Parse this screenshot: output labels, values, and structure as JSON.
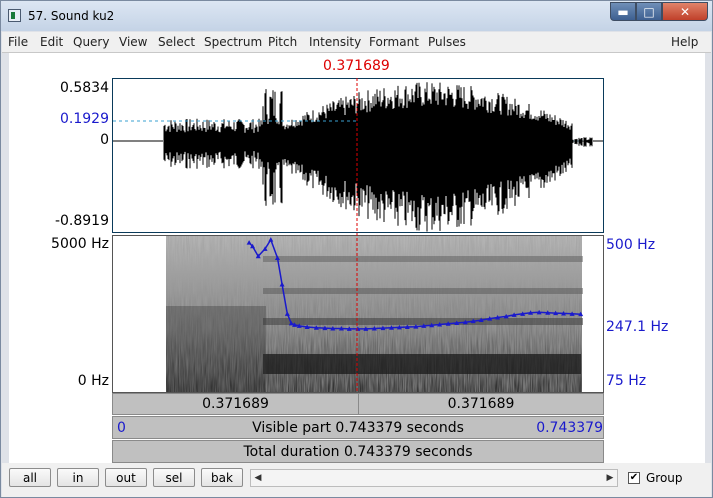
{
  "window": {
    "title": "57. Sound ku2",
    "minimize": "▬",
    "maximize": "□",
    "close": "✕"
  },
  "menu": [
    "File",
    "Edit",
    "Query",
    "View",
    "Select",
    "Spectrum",
    "Pitch",
    "Intensity",
    "Formant",
    "Pulses",
    "Help"
  ],
  "cursor": {
    "time": "0.371689"
  },
  "waveform": {
    "max": "0.5834",
    "cursor_value": "0.1929",
    "zero": "0",
    "min": "-0.8919"
  },
  "spectrogram": {
    "freq_max": "5000 Hz",
    "freq_min": "0 Hz",
    "pitch_max": "500 Hz",
    "pitch_cursor": "247.1 Hz",
    "pitch_min": "75 Hz"
  },
  "pitch_track": {
    "times": [
      0.2065,
      0.2117,
      0.2203,
      0.2307,
      0.2394,
      0.2495,
      0.2565,
      0.2645,
      0.2705,
      0.2755,
      0.2825,
      0.2945,
      0.3085,
      0.3215,
      0.3335,
      0.3465,
      0.3585,
      0.3715,
      0.3835,
      0.3965,
      0.4095,
      0.4225,
      0.4345,
      0.4465,
      0.4595,
      0.4715,
      0.4835,
      0.4955,
      0.5085,
      0.5215,
      0.5345,
      0.5465,
      0.5585,
      0.5715,
      0.5835,
      0.5965,
      0.6085,
      0.6215,
      0.6335,
      0.6465,
      0.6595,
      0.6715,
      0.6835,
      0.6965,
      0.7095
    ],
    "hz": [
      482,
      472,
      445,
      465,
      490,
      440,
      368,
      288,
      262,
      258,
      255,
      252,
      250,
      249,
      248,
      248,
      247,
      247,
      247,
      248,
      249,
      250,
      251,
      252,
      253,
      255,
      257,
      259,
      261,
      263,
      265,
      268,
      271,
      275,
      278,
      281,
      285,
      288,
      291,
      292,
      291,
      290,
      289,
      288,
      287
    ],
    "hz_range": [
      75,
      500
    ],
    "color": "#1a1acc"
  },
  "ruler": {
    "left_segment": "0.371689",
    "right_segment": "0.371689",
    "visible_start": "0",
    "visible_part": "Visible part 0.743379 seconds",
    "visible_end": "0.743379",
    "total": "Total duration 0.743379 seconds"
  },
  "buttons": {
    "all": "all",
    "in": "in",
    "out": "out",
    "sel": "sel",
    "bak": "bak"
  },
  "scroll": {
    "left": "◀",
    "right": "▶"
  },
  "group": {
    "label": "Group",
    "checked": true,
    "mark": "✔"
  },
  "colors": {
    "cursor": "#dd0000",
    "pitch": "#1a1acc",
    "waveform": "#000000"
  }
}
